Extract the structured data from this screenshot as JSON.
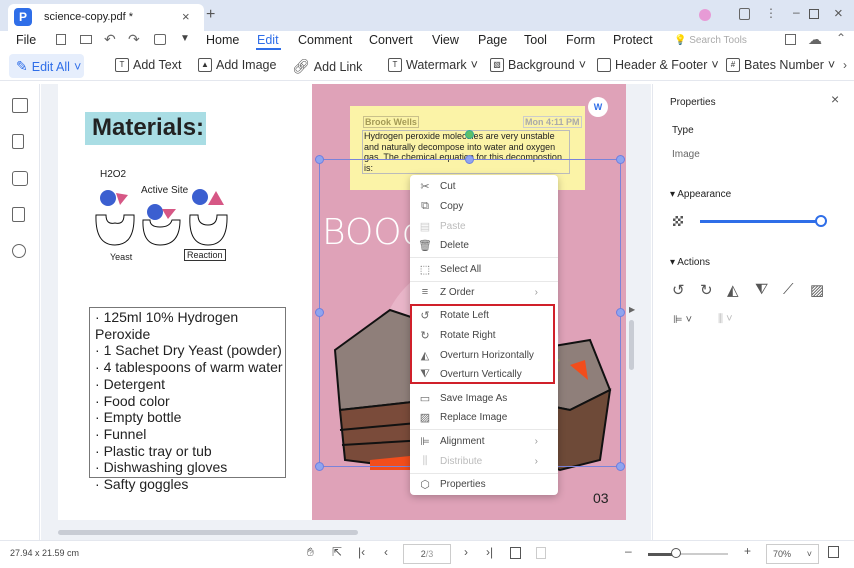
{
  "tab": {
    "title": "science-copy.pdf *"
  },
  "menu": {
    "file": "File",
    "items": [
      "Home",
      "Edit",
      "Comment",
      "Convert",
      "View",
      "Page",
      "Tool",
      "Form",
      "Protect"
    ],
    "active": "Edit",
    "search_placeholder": "Search Tools"
  },
  "toolbar": {
    "edit_all": "Edit All",
    "add_text": "Add Text",
    "add_image": "Add Image",
    "add_link": "Add Link",
    "watermark": "Watermark",
    "background": "Background",
    "header_footer": "Header & Footer",
    "bates": "Bates Number"
  },
  "page": {
    "heading": "Materials:",
    "diagram_labels": [
      "H2O2",
      "Active Site",
      "Yeast",
      "Reaction"
    ],
    "materials": [
      "125ml 10% Hydrogen Peroxide",
      "1 Sachet Dry Yeast (powder)",
      "4 tablespoons of warm water",
      "Detergent",
      "Food color",
      "Empty bottle",
      "Funnel",
      "Plastic tray or tub",
      "Dishwashing gloves",
      "Safty goggles"
    ],
    "booo": "BOOoo",
    "page_number": "03"
  },
  "note": {
    "author": "Brook Wells",
    "time": "Mon 4:11 PM",
    "text": "Hydrogen peroxide molecules are very unstable and naturally decompose into water and oxygen gas. The chemical equation for this decompostion is:"
  },
  "context_menu": {
    "cut": "Cut",
    "copy": "Copy",
    "paste": "Paste",
    "delete": "Delete",
    "select_all": "Select All",
    "z_order": "Z Order",
    "rotate_left": "Rotate Left",
    "rotate_right": "Rotate Right",
    "overturn_h": "Overturn Horizontally",
    "overturn_v": "Overturn Vertically",
    "save_image": "Save Image As",
    "replace_image": "Replace Image",
    "alignment": "Alignment",
    "distribute": "Distribute",
    "properties": "Properties"
  },
  "properties": {
    "title": "Properties",
    "type_label": "Type",
    "type_value": "Image",
    "appearance": "Appearance",
    "opacity": 1.0,
    "actions": "Actions"
  },
  "status": {
    "dimensions": "27.94 x 21.59 cm",
    "page_input": "2",
    "page_total": "/3",
    "zoom": "70%",
    "zoom_fraction": 0.3
  },
  "colors": {
    "accent": "#2f6ee8",
    "highlight_box": "#d0202a",
    "pink": "#dfa2b8",
    "note": "#fbf3a7"
  }
}
